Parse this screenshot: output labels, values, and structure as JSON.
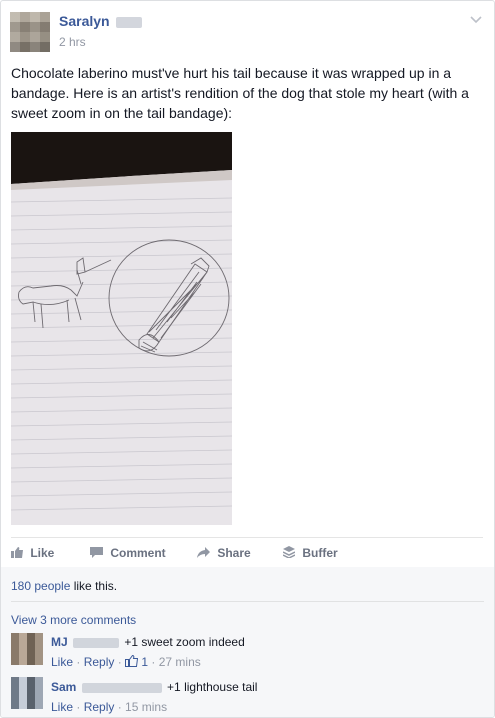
{
  "post": {
    "author": "Saralyn",
    "time": "2 hrs",
    "text": "Chocolate laberino must've hurt his tail because it was wrapped up in a bandage. Here is an artist's rendition of the dog that stole my heart (with a sweet zoom in on the tail bandage):",
    "chevron_icon": "chevron-down-icon"
  },
  "actions": {
    "like": "Like",
    "comment": "Comment",
    "share": "Share",
    "buffer": "Buffer"
  },
  "feedback": {
    "likes_count": "180 people",
    "likes_suffix": " like this.",
    "view_more": "View 3 more comments"
  },
  "comments": [
    {
      "name": "MJ",
      "text": "+1 sweet zoom indeed",
      "like": "Like",
      "reply": "Reply",
      "like_count": "1",
      "time": "27 mins"
    },
    {
      "name": "Sam",
      "text": "+1 lighthouse tail",
      "like": "Like",
      "reply": "Reply",
      "time": "15 mins"
    }
  ]
}
